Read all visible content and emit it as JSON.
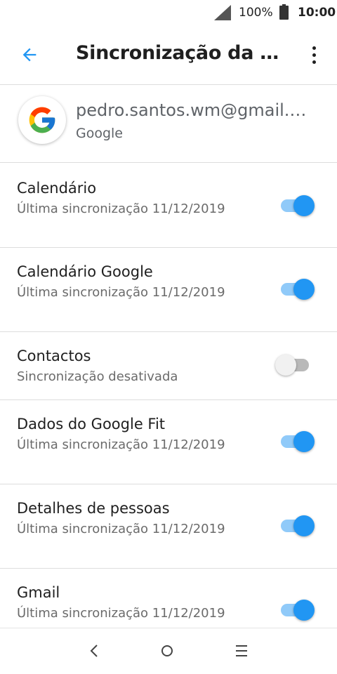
{
  "status_bar": {
    "battery_percent": "100%",
    "time": "10:00",
    "icons": [
      "signal-icon",
      "battery-icon"
    ]
  },
  "app_bar": {
    "title": "Sincronização da conta",
    "back_icon": "arrow-back-icon",
    "menu_icon": "more-vert-icon"
  },
  "account": {
    "email": "pedro.santos.wm@gmail.com",
    "provider": "Google",
    "avatar_icon": "google-logo-icon"
  },
  "sync_items": [
    {
      "label": "Calendário",
      "status": "Última sincronização 11/12/2019",
      "enabled": true
    },
    {
      "label": "Calendário Google",
      "status": "Última sincronização 11/12/2019",
      "enabled": true
    },
    {
      "label": "Contactos",
      "status": "Sincronização desativada",
      "enabled": false
    },
    {
      "label": "Dados do Google Fit",
      "status": "Última sincronização 11/12/2019",
      "enabled": true
    },
    {
      "label": "Detalhes de pessoas",
      "status": "Última sincronização 11/12/2019",
      "enabled": true
    },
    {
      "label": "Gmail",
      "status": "Última sincronização 11/12/2019",
      "enabled": true
    }
  ],
  "nav_bar": {
    "icons": [
      "nav-back-icon",
      "nav-home-icon",
      "nav-recents-icon"
    ]
  },
  "colors": {
    "accent": "#2196f3",
    "accent_track": "#90caf9",
    "back_arrow": "#2196f3",
    "switch_off_thumb": "#f1f1f1",
    "switch_off_track": "#b9b9b9"
  }
}
